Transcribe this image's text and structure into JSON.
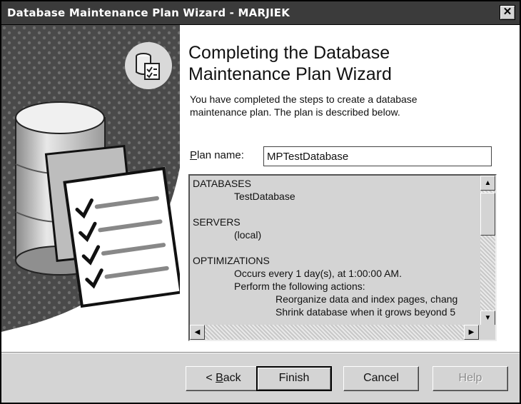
{
  "window": {
    "title": "Database Maintenance Plan Wizard - MARJIEK",
    "close_glyph": "✕"
  },
  "heading": {
    "line1": "Completing the Database",
    "line2": "Maintenance Plan Wizard"
  },
  "description": {
    "line1": "You have completed the steps to create a database",
    "line2": "maintenance plan. The plan is described below."
  },
  "plan_name": {
    "label_first": "P",
    "label_rest": "lan name:",
    "value": "MPTestDatabase"
  },
  "summary": {
    "lines": [
      "DATABASES",
      "TestDatabase",
      "SERVERS",
      "(local)",
      "OPTIMIZATIONS",
      "Occurs every 1 day(s), at 1:00:00 AM.",
      "Perform the following actions:",
      "Reorganize data and index pages, chang",
      "Shrink database when it grows beyond 5"
    ]
  },
  "buttons": {
    "back_prefix": "< ",
    "back_key": "B",
    "back_rest": "ack",
    "finish": "Finish",
    "cancel": "Cancel",
    "help": "Help"
  },
  "icons": {
    "header": "database-checklist-icon",
    "art": "database-checklist-illustration"
  },
  "colors": {
    "titlebar": "#3b3b3b",
    "face": "#d4d4d4"
  }
}
